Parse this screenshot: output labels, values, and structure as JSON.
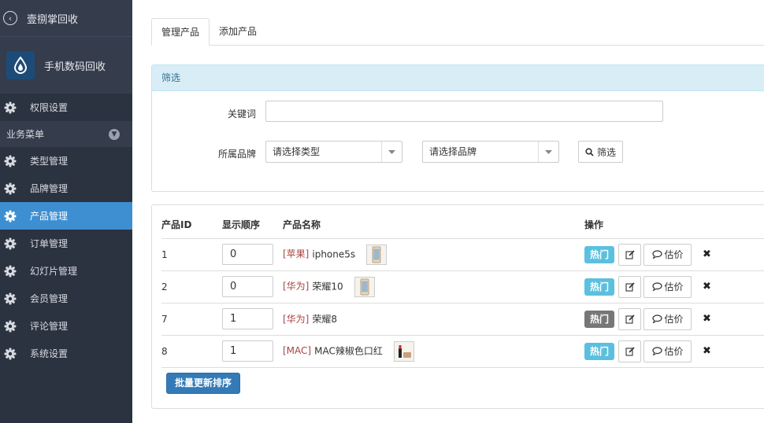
{
  "sidebar": {
    "top_title": "壹捌掌回收",
    "brand_name": "手机数码回收",
    "item_permissions": "权限设置",
    "section_label": "业务菜单",
    "items": [
      {
        "label": "类型管理"
      },
      {
        "label": "品牌管理"
      },
      {
        "label": "产品管理"
      },
      {
        "label": "订单管理"
      },
      {
        "label": "幻灯片管理"
      },
      {
        "label": "会员管理"
      },
      {
        "label": "评论管理"
      },
      {
        "label": "系统设置"
      }
    ],
    "active_index": 2
  },
  "tabs": [
    {
      "label": "管理产品"
    },
    {
      "label": "添加产品"
    }
  ],
  "filter": {
    "panel_title": "筛选",
    "keyword_label": "关键词",
    "keyword_value": "",
    "brand_label": "所属品牌",
    "type_select": "请选择类型",
    "brand_select": "请选择品牌",
    "filter_button": "筛选"
  },
  "table": {
    "headers": [
      "产品ID",
      "显示顺序",
      "产品名称",
      "操作"
    ],
    "rows": [
      {
        "id": "1",
        "order": "0",
        "brand": "[苹果]",
        "name": "iphone5s",
        "hot": "热门",
        "hot_on": true,
        "eval": "估价"
      },
      {
        "id": "2",
        "order": "0",
        "brand": "[华为]",
        "name": "荣耀10",
        "hot": "热门",
        "hot_on": true,
        "eval": "估价"
      },
      {
        "id": "7",
        "order": "1",
        "brand": "[华为]",
        "name": "荣耀8",
        "hot": "热门",
        "hot_on": false,
        "eval": "估价"
      },
      {
        "id": "8",
        "order": "1",
        "brand": "[MAC]",
        "name": "MAC辣椒色口红",
        "hot": "热门",
        "hot_on": true,
        "eval": "估价"
      }
    ],
    "batch_button": "批量更新排序"
  },
  "colors": {
    "sidebar_bg": "#2b3240",
    "active_blue": "#3d8fd1",
    "hot_badge": "#5bc0de",
    "off_badge": "#777777",
    "brand_tag": "#a94442",
    "primary_button": "#337ab7"
  },
  "icons": {
    "back": "circle-chevron-left-icon",
    "logo": "water-drop-icon",
    "menu": "gear-icon",
    "section": "chevron-down-circle-icon",
    "select": "caret-down-icon",
    "search": "search-icon",
    "edit": "edit-icon",
    "eval": "comment-icon",
    "delete": "close-icon"
  }
}
